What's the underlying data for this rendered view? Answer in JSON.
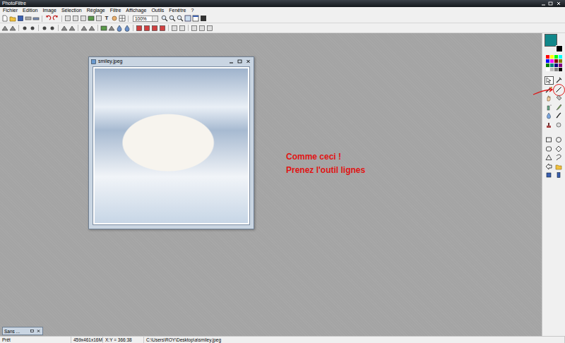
{
  "window": {
    "title": "PhotoFiltre"
  },
  "menu": [
    "Fichier",
    "Edition",
    "Image",
    "Sélection",
    "Réglage",
    "Filtre",
    "Affichage",
    "Outils",
    "Fenêtre",
    "?"
  ],
  "toolbar": {
    "text_tool": "T",
    "zoom": "100%"
  },
  "document": {
    "title": "smiley.jpeg"
  },
  "annotation": {
    "lines": [
      "Comme ceci !",
      "Prenez l'outil lignes"
    ]
  },
  "minimized": {
    "title": "Sans ..."
  },
  "colors": {
    "primary": "#11878a",
    "secondary": "#000000",
    "palette": [
      "#ff0000",
      "#ffff00",
      "#00ff00",
      "#00ffff",
      "#0000ff",
      "#ff00ff",
      "#800000",
      "#808000",
      "#008000",
      "#008080",
      "#000080",
      "#800080",
      "#ffffff",
      "#c0c0c0",
      "#808080",
      "#000000"
    ]
  },
  "tools": [
    {
      "selected": true,
      "circled": false
    },
    {
      "selected": false,
      "circled": false
    },
    {
      "selected": false,
      "circled": false
    },
    {
      "selected": false,
      "circled": true
    },
    {
      "selected": false,
      "circled": false
    },
    {
      "selected": false,
      "circled": false
    },
    {
      "selected": false,
      "circled": false
    },
    {
      "selected": false,
      "circled": false
    },
    {
      "selected": false,
      "circled": false
    },
    {
      "selected": false,
      "circled": false
    },
    {
      "selected": false,
      "circled": false
    },
    {
      "selected": false,
      "circled": false
    },
    {
      "selected": false,
      "circled": false
    },
    {
      "selected": false,
      "circled": false
    },
    {
      "selected": false,
      "circled": false
    },
    {
      "selected": false,
      "circled": false
    },
    {
      "selected": false,
      "circled": false
    },
    {
      "selected": false,
      "circled": false
    },
    {
      "selected": false,
      "circled": false
    },
    {
      "selected": false,
      "circled": false
    },
    {
      "selected": false,
      "circled": false
    },
    {
      "selected": false,
      "circled": false
    }
  ],
  "status_bar": [
    "Prêt",
    "459x461x16M",
    "X:Y = 366:38",
    "C:\\Users\\ROY\\Desktop\\a\\smiley.jpeg"
  ]
}
